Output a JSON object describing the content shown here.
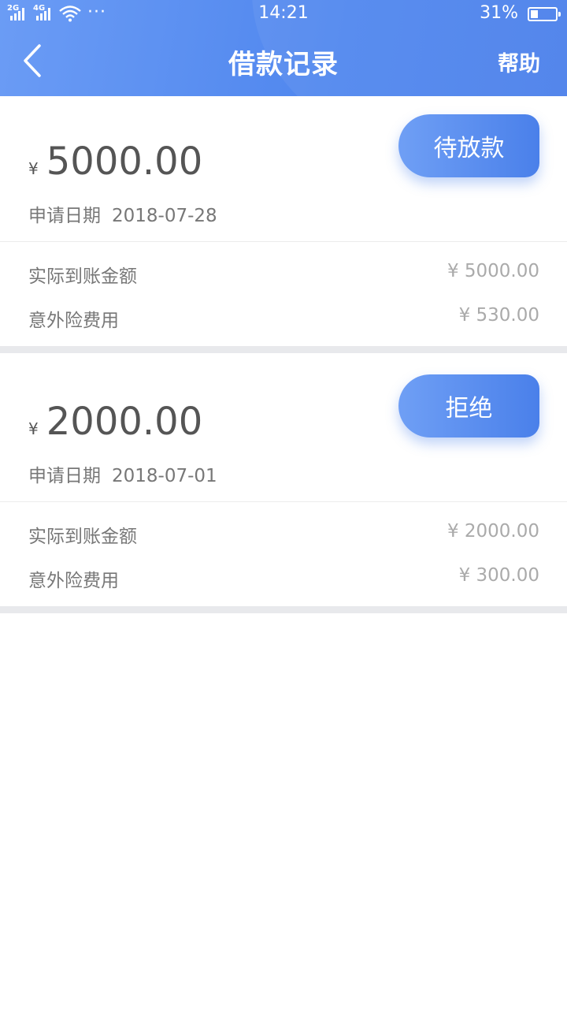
{
  "status_bar": {
    "net1": "2G",
    "net2": "4G",
    "dots": "···",
    "time": "14:21",
    "battery_pct": "31%",
    "battery_level": 0.31
  },
  "nav": {
    "back_icon": "chevron-left-icon",
    "title": "借款记录",
    "help_label": "帮助"
  },
  "records": [
    {
      "currency": "¥",
      "amount": "5000.00",
      "date_label": "申请日期",
      "date": "2018-07-28",
      "status": "待放款",
      "received_label": "实际到账金额",
      "received": "¥ 5000.00",
      "insurance_label": "意外险费用",
      "insurance": "¥ 530.00"
    },
    {
      "currency": "¥",
      "amount": "2000.00",
      "date_label": "申请日期",
      "date": "2018-07-01",
      "status": "拒绝",
      "received_label": "实际到账金额",
      "received": "¥ 2000.00",
      "insurance_label": "意外险费用",
      "insurance": "¥ 300.00"
    }
  ],
  "colors": {
    "header_start": "#6b9cf5",
    "header_end": "#4a7fea",
    "button_start": "#6f9ff5",
    "button_end": "#4a80ea",
    "separator": "#e8e9ec"
  }
}
